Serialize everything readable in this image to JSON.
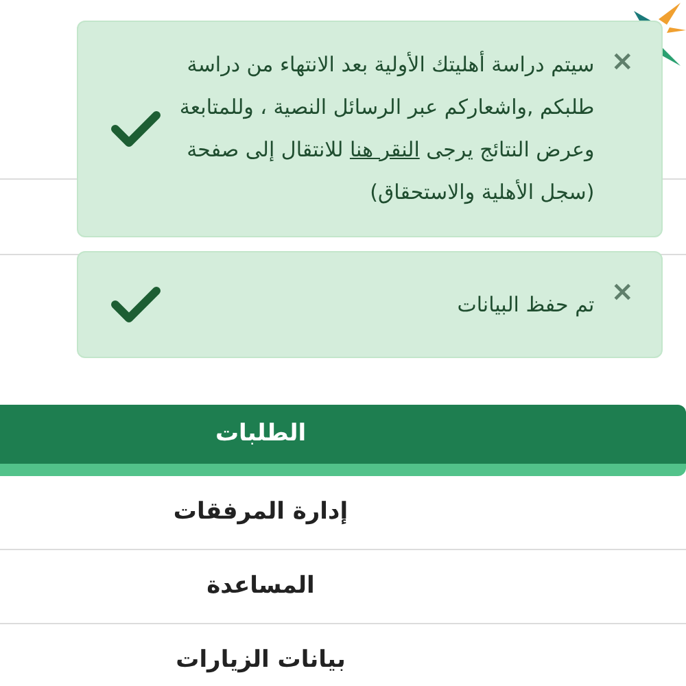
{
  "menu": {
    "items": [
      {
        "label": "الطلبات",
        "selected": true
      },
      {
        "label": "إدارة المرفقات",
        "selected": false
      },
      {
        "label": "المساعدة",
        "selected": false
      },
      {
        "label": "بيانات الزيارات",
        "selected": false
      }
    ]
  },
  "toasts": [
    {
      "close": "×",
      "text_before": "سيتم دراسة أهليتك الأولية بعد الانتهاء من دراسة طلبكم ,واشعاركم عبر الرسائل النصية ، وللمتابعة وعرض النتائج يرجى ",
      "link": "النقر هنا",
      "text_after": " للانتقال إلى صفحة (سجل الأهلية والاستحقاق)"
    },
    {
      "close": "×",
      "text_before": "تم حفظ البيانات"
    }
  ]
}
